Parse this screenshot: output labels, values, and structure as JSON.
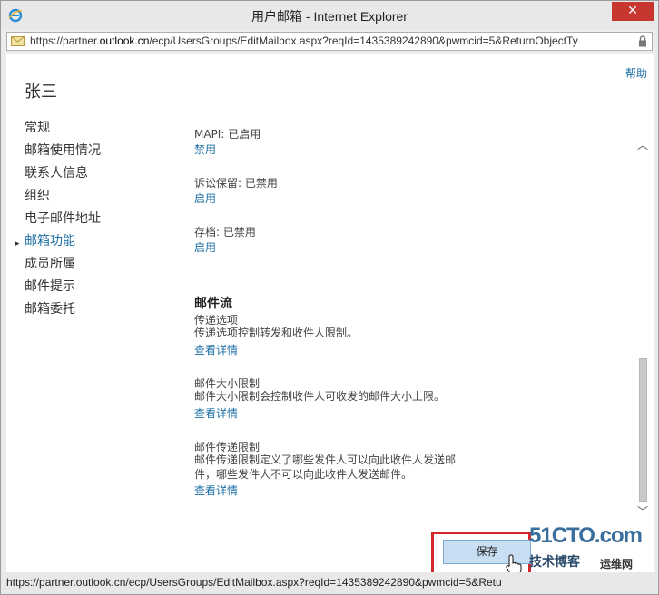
{
  "window": {
    "title": "用户邮箱 - Internet Explorer",
    "close_glyph": "✕"
  },
  "address_bar": {
    "url_prefix": "https://partner.",
    "url_domain": "outlook.cn",
    "url_suffix": "/ecp/UsersGroups/EditMailbox.aspx?reqId=1435389242890&pwmcid=5&ReturnObjectTy"
  },
  "header": {
    "help": "帮助",
    "user_name": "张三"
  },
  "nav": {
    "items": [
      {
        "label": "常规",
        "active": false
      },
      {
        "label": "邮箱使用情况",
        "active": false
      },
      {
        "label": "联系人信息",
        "active": false
      },
      {
        "label": "组织",
        "active": false
      },
      {
        "label": "电子邮件地址",
        "active": false
      },
      {
        "label": "邮箱功能",
        "active": true
      },
      {
        "label": "成员所属",
        "active": false
      },
      {
        "label": "邮件提示",
        "active": false
      },
      {
        "label": "邮箱委托",
        "active": false
      }
    ],
    "active_marker": "▸"
  },
  "features": {
    "mapi_label": "MAPI: 已启用",
    "mapi_action": "禁用",
    "litigation_label": "诉讼保留: 已禁用",
    "litigation_action": "启用",
    "archive_label": "存档: 已禁用",
    "archive_action": "启用"
  },
  "mail_flow": {
    "title": "邮件流",
    "delivery_title": "传递选项",
    "delivery_desc": "传递选项控制转发和收件人限制。",
    "delivery_link": "查看详情",
    "size_title": "邮件大小限制",
    "size_desc": "邮件大小限制会控制收件人可收发的邮件大小上限。",
    "size_link": "查看详情",
    "restrict_title": "邮件传递限制",
    "restrict_desc": "邮件传递限制定义了哪些发件人可以向此收件人发送邮件，哪些发件人不可以向此收件人发送邮件。",
    "restrict_link": "查看详情"
  },
  "scrollbar": {
    "up_glyph": "︿",
    "down_glyph": "﹀"
  },
  "footer": {
    "save": "保存"
  },
  "status_bar": {
    "url": "https://partner.outlook.cn/ecp/UsersGroups/EditMailbox.aspx?reqId=1435389242890&pwmcid=5&Retu"
  },
  "watermark": {
    "main": "51CTO.com",
    "sub": "技术博客",
    "sub2": "运维网"
  }
}
